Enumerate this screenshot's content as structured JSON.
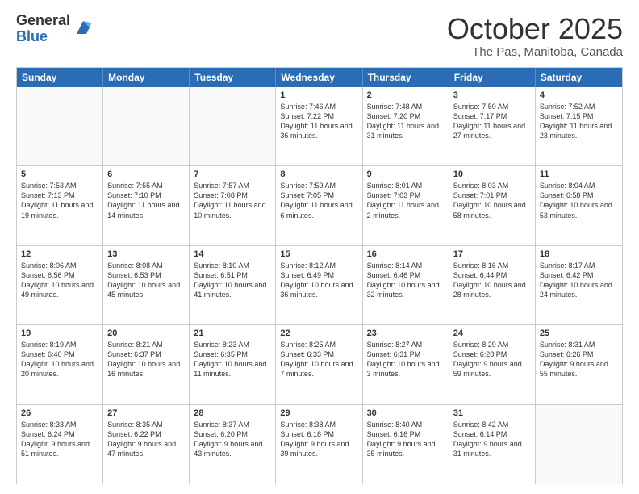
{
  "logo": {
    "general": "General",
    "blue": "Blue"
  },
  "title": "October 2025",
  "location": "The Pas, Manitoba, Canada",
  "days": [
    "Sunday",
    "Monday",
    "Tuesday",
    "Wednesday",
    "Thursday",
    "Friday",
    "Saturday"
  ],
  "weeks": [
    [
      {
        "day": "",
        "info": ""
      },
      {
        "day": "",
        "info": ""
      },
      {
        "day": "",
        "info": ""
      },
      {
        "day": "1",
        "info": "Sunrise: 7:46 AM\nSunset: 7:22 PM\nDaylight: 11 hours and 36 minutes."
      },
      {
        "day": "2",
        "info": "Sunrise: 7:48 AM\nSunset: 7:20 PM\nDaylight: 11 hours and 31 minutes."
      },
      {
        "day": "3",
        "info": "Sunrise: 7:50 AM\nSunset: 7:17 PM\nDaylight: 11 hours and 27 minutes."
      },
      {
        "day": "4",
        "info": "Sunrise: 7:52 AM\nSunset: 7:15 PM\nDaylight: 11 hours and 23 minutes."
      }
    ],
    [
      {
        "day": "5",
        "info": "Sunrise: 7:53 AM\nSunset: 7:13 PM\nDaylight: 11 hours and 19 minutes."
      },
      {
        "day": "6",
        "info": "Sunrise: 7:55 AM\nSunset: 7:10 PM\nDaylight: 11 hours and 14 minutes."
      },
      {
        "day": "7",
        "info": "Sunrise: 7:57 AM\nSunset: 7:08 PM\nDaylight: 11 hours and 10 minutes."
      },
      {
        "day": "8",
        "info": "Sunrise: 7:59 AM\nSunset: 7:05 PM\nDaylight: 11 hours and 6 minutes."
      },
      {
        "day": "9",
        "info": "Sunrise: 8:01 AM\nSunset: 7:03 PM\nDaylight: 11 hours and 2 minutes."
      },
      {
        "day": "10",
        "info": "Sunrise: 8:03 AM\nSunset: 7:01 PM\nDaylight: 10 hours and 58 minutes."
      },
      {
        "day": "11",
        "info": "Sunrise: 8:04 AM\nSunset: 6:58 PM\nDaylight: 10 hours and 53 minutes."
      }
    ],
    [
      {
        "day": "12",
        "info": "Sunrise: 8:06 AM\nSunset: 6:56 PM\nDaylight: 10 hours and 49 minutes."
      },
      {
        "day": "13",
        "info": "Sunrise: 8:08 AM\nSunset: 6:53 PM\nDaylight: 10 hours and 45 minutes."
      },
      {
        "day": "14",
        "info": "Sunrise: 8:10 AM\nSunset: 6:51 PM\nDaylight: 10 hours and 41 minutes."
      },
      {
        "day": "15",
        "info": "Sunrise: 8:12 AM\nSunset: 6:49 PM\nDaylight: 10 hours and 36 minutes."
      },
      {
        "day": "16",
        "info": "Sunrise: 8:14 AM\nSunset: 6:46 PM\nDaylight: 10 hours and 32 minutes."
      },
      {
        "day": "17",
        "info": "Sunrise: 8:16 AM\nSunset: 6:44 PM\nDaylight: 10 hours and 28 minutes."
      },
      {
        "day": "18",
        "info": "Sunrise: 8:17 AM\nSunset: 6:42 PM\nDaylight: 10 hours and 24 minutes."
      }
    ],
    [
      {
        "day": "19",
        "info": "Sunrise: 8:19 AM\nSunset: 6:40 PM\nDaylight: 10 hours and 20 minutes."
      },
      {
        "day": "20",
        "info": "Sunrise: 8:21 AM\nSunset: 6:37 PM\nDaylight: 10 hours and 16 minutes."
      },
      {
        "day": "21",
        "info": "Sunrise: 8:23 AM\nSunset: 6:35 PM\nDaylight: 10 hours and 11 minutes."
      },
      {
        "day": "22",
        "info": "Sunrise: 8:25 AM\nSunset: 6:33 PM\nDaylight: 10 hours and 7 minutes."
      },
      {
        "day": "23",
        "info": "Sunrise: 8:27 AM\nSunset: 6:31 PM\nDaylight: 10 hours and 3 minutes."
      },
      {
        "day": "24",
        "info": "Sunrise: 8:29 AM\nSunset: 6:28 PM\nDaylight: 9 hours and 59 minutes."
      },
      {
        "day": "25",
        "info": "Sunrise: 8:31 AM\nSunset: 6:26 PM\nDaylight: 9 hours and 55 minutes."
      }
    ],
    [
      {
        "day": "26",
        "info": "Sunrise: 8:33 AM\nSunset: 6:24 PM\nDaylight: 9 hours and 51 minutes."
      },
      {
        "day": "27",
        "info": "Sunrise: 8:35 AM\nSunset: 6:22 PM\nDaylight: 9 hours and 47 minutes."
      },
      {
        "day": "28",
        "info": "Sunrise: 8:37 AM\nSunset: 6:20 PM\nDaylight: 9 hours and 43 minutes."
      },
      {
        "day": "29",
        "info": "Sunrise: 8:38 AM\nSunset: 6:18 PM\nDaylight: 9 hours and 39 minutes."
      },
      {
        "day": "30",
        "info": "Sunrise: 8:40 AM\nSunset: 6:16 PM\nDaylight: 9 hours and 35 minutes."
      },
      {
        "day": "31",
        "info": "Sunrise: 8:42 AM\nSunset: 6:14 PM\nDaylight: 9 hours and 31 minutes."
      },
      {
        "day": "",
        "info": ""
      }
    ]
  ]
}
